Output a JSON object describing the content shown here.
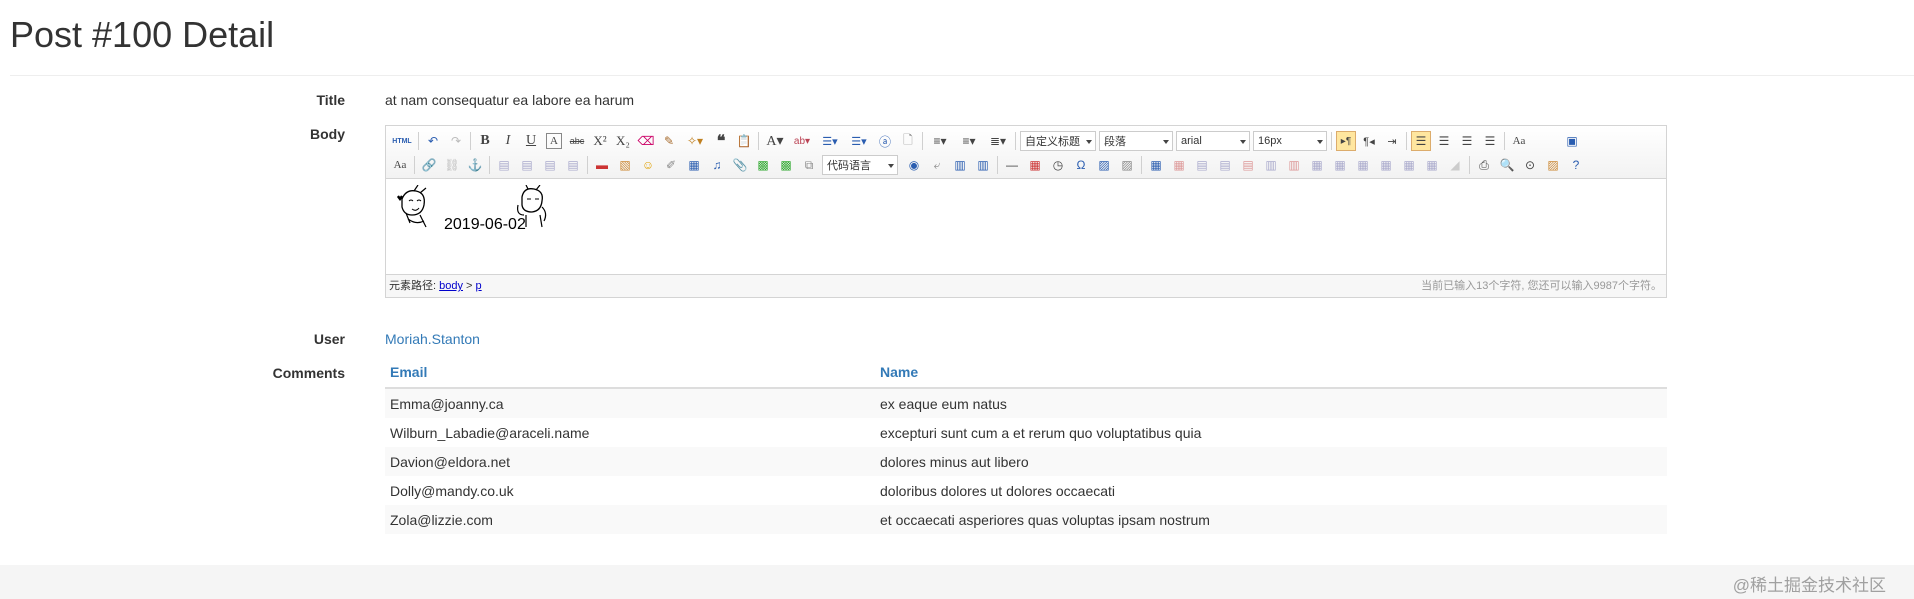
{
  "page": {
    "title": "Post #100 Detail"
  },
  "fields": {
    "title_label": "Title",
    "title_value": "at nam consequatur ea labore ea harum",
    "body_label": "Body",
    "user_label": "User",
    "user_value": "Moriah.Stanton",
    "comments_label": "Comments"
  },
  "editor": {
    "toolbar": {
      "html_label": "HTML",
      "custom_title_select": "自定义标题",
      "paragraph_select": "段落",
      "font_select": "arial",
      "size_select": "16px",
      "code_lang_select": "代码语言"
    },
    "content": {
      "date_text": "2019-06-02"
    },
    "status": {
      "path_label": "元素路径:",
      "path_body": "body",
      "path_sep": ">",
      "path_p": "p",
      "counter": "当前已输入13个字符, 您还可以输入9987个字符。"
    }
  },
  "comments": {
    "headers": {
      "email": "Email",
      "name": "Name"
    },
    "rows": [
      {
        "email": "Emma@joanny.ca",
        "name": "ex eaque eum natus"
      },
      {
        "email": "Wilburn_Labadie@araceli.name",
        "name": "excepturi sunt cum a et rerum quo voluptatibus quia"
      },
      {
        "email": "Davion@eldora.net",
        "name": "dolores minus aut libero"
      },
      {
        "email": "Dolly@mandy.co.uk",
        "name": "doloribus dolores ut dolores occaecati"
      },
      {
        "email": "Zola@lizzie.com",
        "name": "et occaecati asperiores quas voluptas ipsam nostrum"
      }
    ]
  },
  "watermark": "@稀土掘金技术社区",
  "colors": {
    "link": "#337ab7",
    "active_button": "#ffe69f"
  }
}
